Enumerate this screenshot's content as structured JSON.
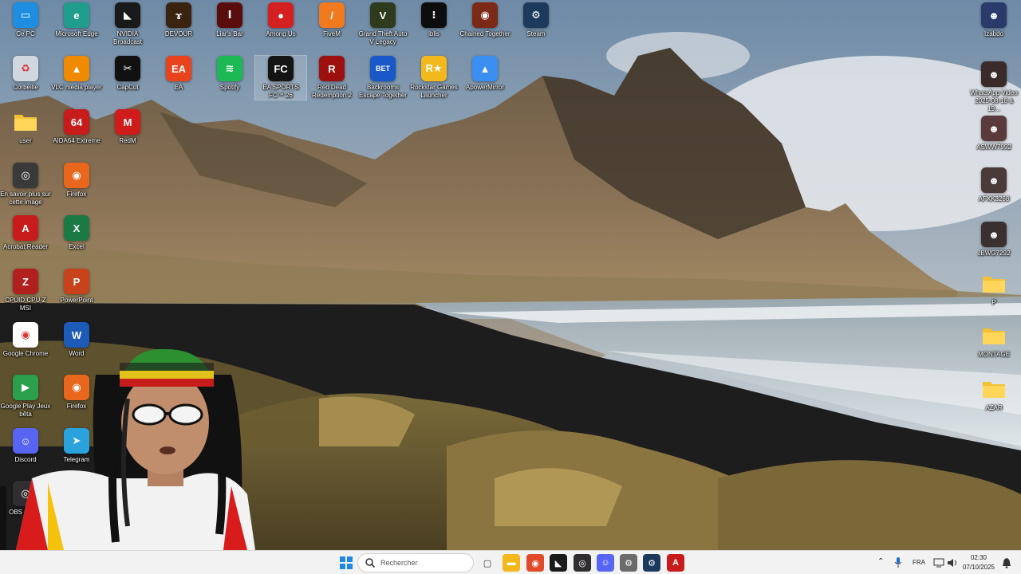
{
  "desktop": {
    "icons": [
      {
        "id": "ce-pc",
        "label": "Ce PC",
        "icon": "monitor-icon",
        "color": "#1e8fe0"
      },
      {
        "id": "edge",
        "label": "Microsoft Edge",
        "icon": "edge-icon",
        "color": "#1f9e8e"
      },
      {
        "id": "nvidia",
        "label": "NVIDIA Broadcast",
        "icon": "nvidia-icon",
        "color": "#1a1a1a"
      },
      {
        "id": "devour",
        "label": "DEVOUR",
        "icon": "devour-icon",
        "color": "#3a2410"
      },
      {
        "id": "liars-bar",
        "label": "Liar's Bar",
        "icon": "liars-bar-icon",
        "color": "#5a0d0d"
      },
      {
        "id": "among-us",
        "label": "Among Us",
        "icon": "among-us-icon",
        "color": "#d42020"
      },
      {
        "id": "fivem",
        "label": "FiveM",
        "icon": "fivem-icon",
        "color": "#f07a1d"
      },
      {
        "id": "gta5",
        "label": "Grand Theft Auto V Legacy",
        "icon": "gta-icon",
        "color": "#2e3b1c"
      },
      {
        "id": "iblis",
        "label": "iblis",
        "icon": "iblis-icon",
        "color": "#0d0d0d"
      },
      {
        "id": "chained",
        "label": "Chained Together",
        "icon": "chained-icon",
        "color": "#7a2a16"
      },
      {
        "id": "steam",
        "label": "Steam",
        "icon": "steam-icon",
        "color": "#1b3a5c"
      },
      {
        "id": "corbeille",
        "label": "Corbeille",
        "icon": "recycle-bin-icon",
        "color": "#cfd8df"
      },
      {
        "id": "vlc",
        "label": "VLC media player",
        "icon": "vlc-icon",
        "color": "#f08a00"
      },
      {
        "id": "capcut",
        "label": "CapCut",
        "icon": "capcut-icon",
        "color": "#111111"
      },
      {
        "id": "ea",
        "label": "EA",
        "icon": "ea-icon",
        "color": "#e8431c"
      },
      {
        "id": "spotify",
        "label": "Spotify",
        "icon": "spotify-icon",
        "color": "#1db954"
      },
      {
        "id": "eafc",
        "label": "EA SPORTS FC™ 26",
        "icon": "ea-fc-icon",
        "color": "#141414",
        "selected": true
      },
      {
        "id": "rdr2",
        "label": "Red Dead Redemption 2",
        "icon": "rdr2-icon",
        "color": "#9e1010"
      },
      {
        "id": "backrooms",
        "label": "Backrooms Escape Together",
        "icon": "backrooms-icon",
        "color": "#1a58c8"
      },
      {
        "id": "rockstar",
        "label": "Rockstar Games Launcher",
        "icon": "rockstar-icon",
        "color": "#f3b81c"
      },
      {
        "id": "apower",
        "label": "ApowerMirror",
        "icon": "apowermirror-icon",
        "color": "#3a8ff0"
      },
      {
        "id": "user",
        "label": "user",
        "icon": "folder-icon",
        "color": "#f3c133"
      },
      {
        "id": "aida64",
        "label": "AIDA64 Extreme",
        "icon": "aida64-icon",
        "color": "#c81c1c"
      },
      {
        "id": "redm",
        "label": "RedM",
        "icon": "redm-icon",
        "color": "#d11b1b"
      },
      {
        "id": "en-savoir",
        "label": "En savoir plus sur cette image",
        "icon": "camera-info-icon",
        "color": "#3a3a3a"
      },
      {
        "id": "firefox1",
        "label": "Firefox",
        "icon": "firefox-icon",
        "color": "#e8671c"
      },
      {
        "id": "acrobat",
        "label": "Acrobat Reader",
        "icon": "acrobat-icon",
        "color": "#c81c1c"
      },
      {
        "id": "excel",
        "label": "Excel",
        "icon": "excel-icon",
        "color": "#1b7a43"
      },
      {
        "id": "cpuz",
        "label": "CPUID CPU-Z MSI",
        "icon": "cpuz-icon",
        "color": "#b21f1f"
      },
      {
        "id": "powerpoint",
        "label": "PowerPoint",
        "icon": "powerpoint-icon",
        "color": "#c8431c"
      },
      {
        "id": "chrome",
        "label": "Google Chrome",
        "icon": "chrome-icon",
        "color": "#ffffff"
      },
      {
        "id": "word",
        "label": "Word",
        "icon": "word-icon",
        "color": "#1d5bb8"
      },
      {
        "id": "gplay",
        "label": "Google Play Jeux bêta",
        "icon": "google-play-games-icon",
        "color": "#2c9f4b"
      },
      {
        "id": "firefox2",
        "label": "Firefox",
        "icon": "firefox-icon",
        "color": "#e8671c"
      },
      {
        "id": "discord",
        "label": "Discord",
        "icon": "discord-icon",
        "color": "#5865f2"
      },
      {
        "id": "telegram",
        "label": "Telegram",
        "icon": "telegram-icon",
        "color": "#2aa3dc"
      },
      {
        "id": "obs",
        "label": "OBS Studio",
        "icon": "obs-icon",
        "color": "#302e31"
      },
      {
        "id": "izabdo",
        "label": "Izabdo",
        "icon": "user-photo-icon",
        "color": "#2a3a6a"
      },
      {
        "id": "whatsapp-video",
        "label": "WhatsApp Video 2025-08-18 à 19...",
        "icon": "video-thumbnail-icon",
        "color": "#3a2a2a"
      },
      {
        "id": "asww",
        "label": "ASWW7992",
        "icon": "video-thumbnail-icon",
        "color": "#5a3a3a"
      },
      {
        "id": "afxk",
        "label": "AFXK3268",
        "icon": "video-thumbnail-icon",
        "color": "#4a3a3a"
      },
      {
        "id": "jbwg",
        "label": "JBWG7292",
        "icon": "video-thumbnail-icon",
        "color": "#3a3030"
      },
      {
        "id": "p-folder",
        "label": "P",
        "icon": "folder-icon",
        "color": "#f3c133"
      },
      {
        "id": "montage",
        "label": "MONTAGE",
        "icon": "folder-icon",
        "color": "#f3c133"
      },
      {
        "id": "azar",
        "label": "AZAR",
        "icon": "folder-icon",
        "color": "#f3c133"
      }
    ]
  },
  "taskbar": {
    "search_placeholder": "Rechercher",
    "language": "FRA",
    "time": "02:30",
    "date": "07/10/2025",
    "pinned": [
      {
        "id": "start",
        "icon": "windows-start-icon",
        "color": "#1e88e5"
      },
      {
        "id": "taskview",
        "icon": "task-view-icon",
        "color": "#444444"
      },
      {
        "id": "explorer",
        "icon": "file-explorer-icon",
        "color": "#f3b81c"
      },
      {
        "id": "chrome",
        "icon": "chrome-icon",
        "color": "#e04a2a"
      },
      {
        "id": "nvidia",
        "icon": "nvidia-icon",
        "color": "#1a1a1a"
      },
      {
        "id": "obs",
        "icon": "obs-icon",
        "color": "#302e31"
      },
      {
        "id": "discord",
        "icon": "discord-icon",
        "color": "#5865f2"
      },
      {
        "id": "settings",
        "icon": "gear-icon",
        "color": "#6b6b6b"
      },
      {
        "id": "steam",
        "icon": "steam-icon",
        "color": "#1b3a5c"
      },
      {
        "id": "acrobat",
        "icon": "acrobat-icon",
        "color": "#c81c1c"
      }
    ]
  }
}
